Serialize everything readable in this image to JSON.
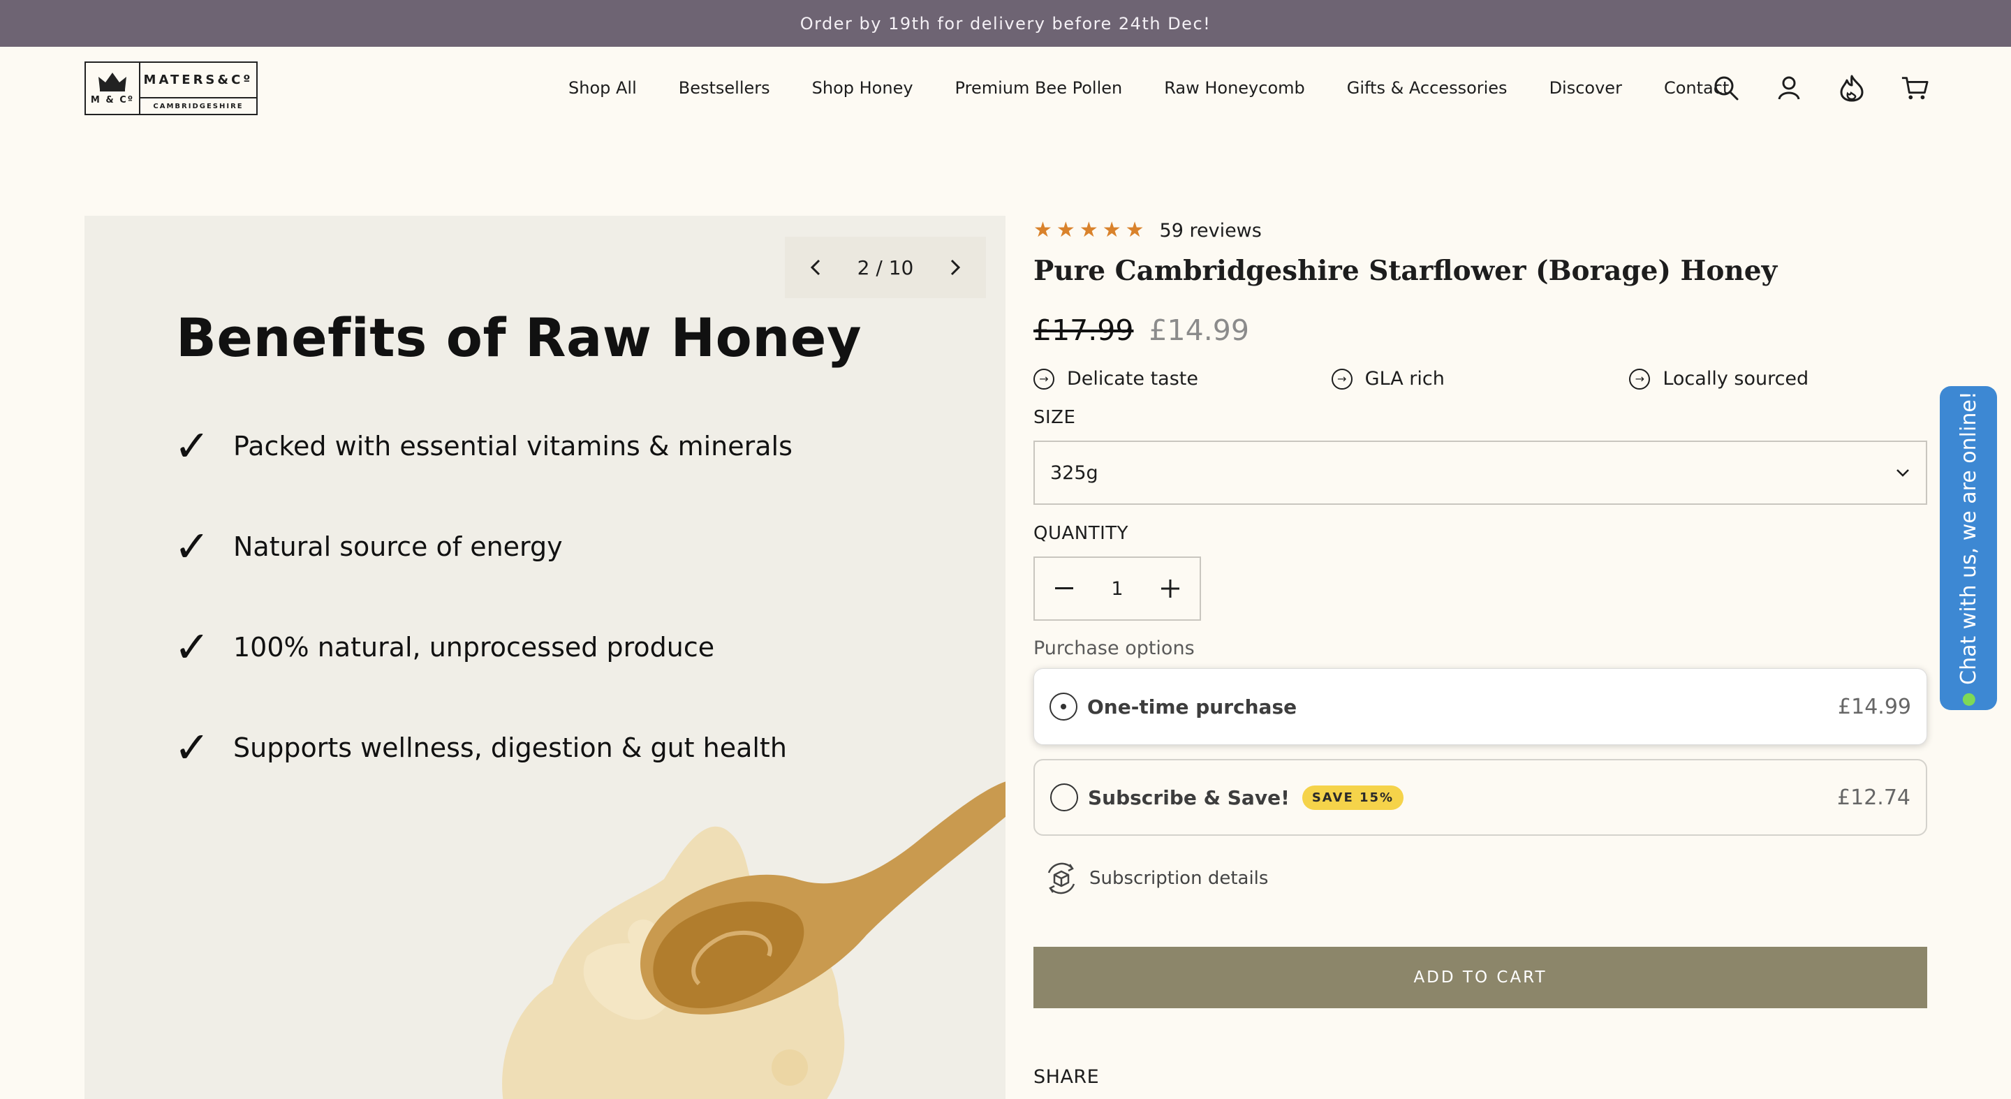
{
  "announcement": "Order by 19th for delivery before 24th Dec!",
  "logo": {
    "brand": "MATERS&Cº",
    "monogram": "M & Cº",
    "county": "CAMBRIDGESHIRE"
  },
  "nav": {
    "items": [
      "Shop All",
      "Bestsellers",
      "Shop Honey",
      "Premium Bee Pollen",
      "Raw Honeycomb",
      "Gifts & Accessories",
      "Discover",
      "Contact"
    ]
  },
  "header_icons": [
    "search-icon",
    "account-icon",
    "loyalty-flame-icon",
    "cart-icon"
  ],
  "gallery": {
    "pager": "2 / 10",
    "heading": "Benefits of Raw Honey",
    "benefits": [
      "Packed with essential vitamins & minerals",
      "Natural source of energy",
      "100% natural, unprocessed produce",
      "Supports wellness, digestion & gut health"
    ]
  },
  "product": {
    "rating": 5,
    "reviews": "59 reviews",
    "title": "Pure Cambridgeshire Starflower (Borage) Honey",
    "price_old": "£17.99",
    "price_new": "£14.99",
    "features": [
      "Delicate taste",
      "GLA rich",
      "Locally sourced"
    ],
    "size_label": "SIZE",
    "size_value": "325g",
    "quantity_label": "QUANTITY",
    "quantity": "1",
    "purchase_options_label": "Purchase options",
    "options": [
      {
        "name": "One-time purchase",
        "price": "£14.99",
        "selected": true
      },
      {
        "name": "Subscribe & Save!",
        "badge": "SAVE 15%",
        "price": "£12.74",
        "selected": false
      }
    ],
    "subscription_details": "Subscription details",
    "add_to_cart": "ADD TO CART",
    "share": "SHARE"
  },
  "chat": {
    "label": "Chat with us, we are online!"
  },
  "colors": {
    "announcement_bg": "#6e6473",
    "add_to_cart_bg": "#8c866a",
    "star": "#d9822b",
    "chat_bg": "#3d88d3",
    "badge_bg": "#f5d34a"
  }
}
